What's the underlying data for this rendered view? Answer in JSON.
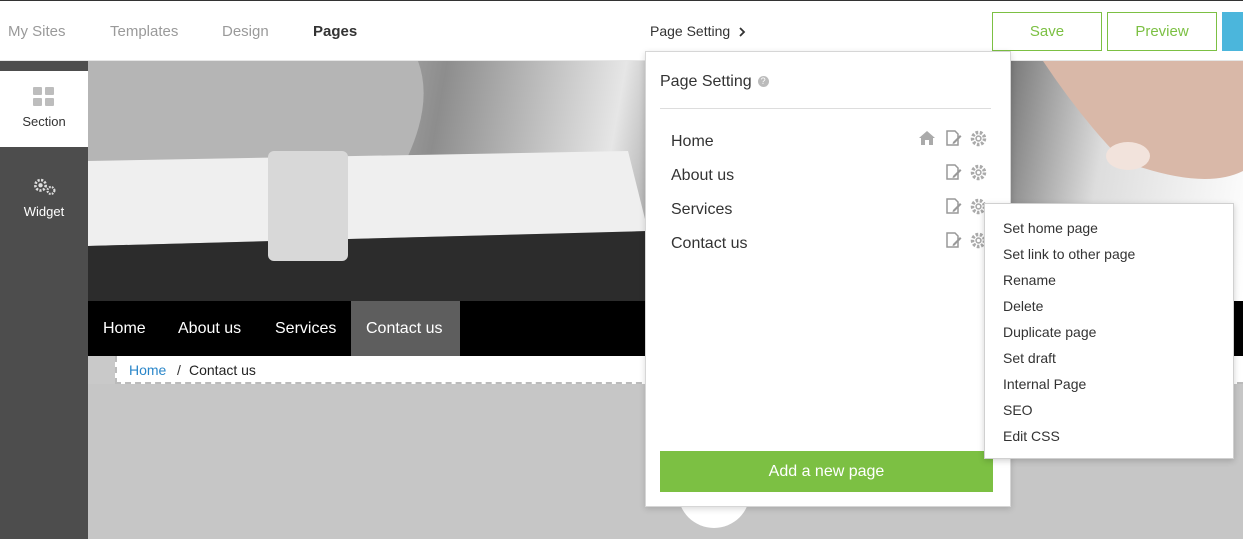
{
  "topbar": {
    "nav": [
      "My Sites",
      "Templates",
      "Design",
      "Pages"
    ],
    "page_setting_link": "Page Setting",
    "save_label": "Save",
    "preview_label": "Preview"
  },
  "sidebar": {
    "items": [
      {
        "label": "Section",
        "icon": "grid-icon"
      },
      {
        "label": "Widget",
        "icon": "gears-icon"
      }
    ]
  },
  "site": {
    "menu": [
      "Home",
      "About us",
      "Services",
      "Contact us"
    ],
    "selected_menu": "Contact us",
    "breadcrumb": {
      "home": "Home",
      "separator": "/",
      "current": "Contact us"
    }
  },
  "panel": {
    "title": "Page Setting",
    "pages": [
      {
        "name": "Home",
        "icons": [
          "home-icon",
          "edit-page-icon",
          "gear-icon"
        ]
      },
      {
        "name": "About us",
        "icons": [
          "edit-page-icon",
          "gear-icon"
        ]
      },
      {
        "name": "Services",
        "icons": [
          "edit-page-icon",
          "gear-icon"
        ]
      },
      {
        "name": "Contact us",
        "icons": [
          "edit-page-icon",
          "gear-icon"
        ]
      }
    ],
    "add_button": "Add a new page"
  },
  "context_menu": {
    "items": [
      "Set home page",
      "Set link to other page",
      "Rename",
      "Delete",
      "Duplicate page",
      "Set draft",
      "Internal Page",
      "SEO",
      "Edit CSS"
    ]
  },
  "colors": {
    "accent_green": "#7cc043",
    "accent_blue": "#4bb6dc",
    "sidebar_bg": "#4d4d4d"
  }
}
